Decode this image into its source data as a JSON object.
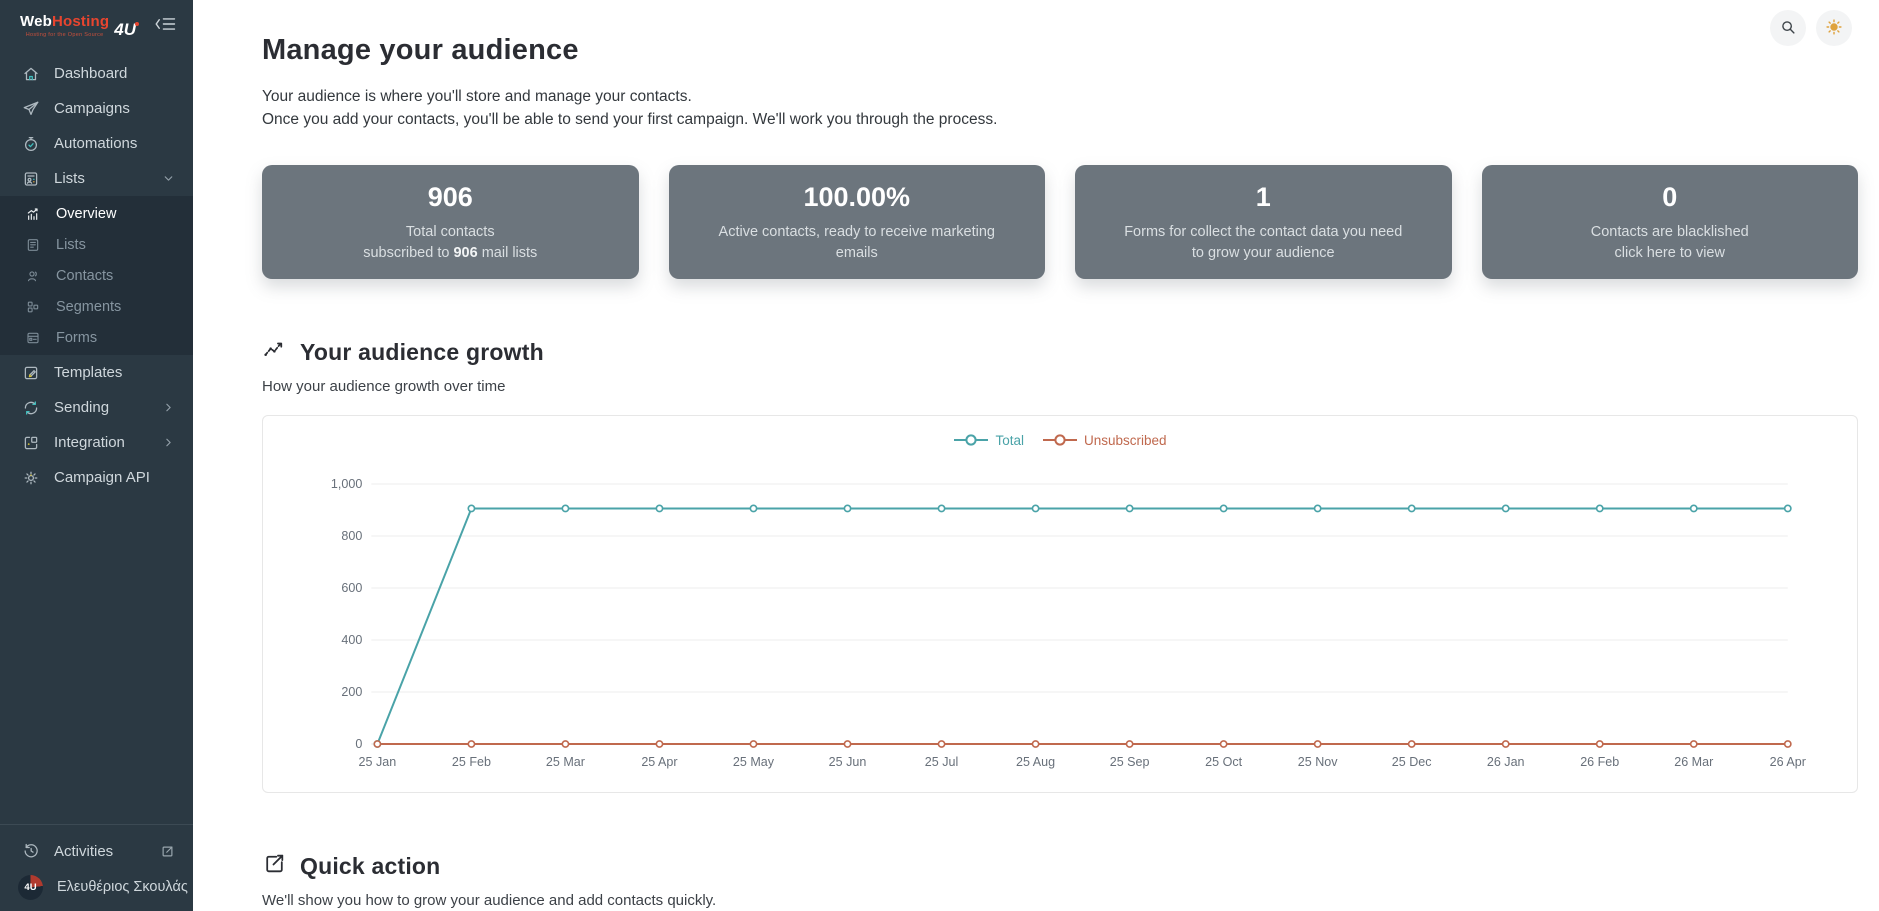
{
  "brand": {
    "web": "Web",
    "hosting": "Hosting",
    "suffix": "4U",
    "tagline": "Hosting for the Open Source"
  },
  "theme": {
    "sidebar_bg": "#2b3943",
    "submenu_bg": "#232f39",
    "brand_red": "#e8452f",
    "card_gray": "#6c757d",
    "sun_yellow": "#dfa23c",
    "accent_teal": "#3fbdbd"
  },
  "sidebar": {
    "nav": [
      {
        "label": "Dashboard",
        "icon": "home-icon"
      },
      {
        "label": "Campaigns",
        "icon": "paper-plane-icon"
      },
      {
        "label": "Automations",
        "icon": "stopwatch-icon"
      },
      {
        "label": "Lists",
        "icon": "lists-icon",
        "expanded": true
      },
      {
        "label": "Templates",
        "icon": "brush-icon"
      },
      {
        "label": "Sending",
        "icon": "sync-icon",
        "has_submenu": true
      },
      {
        "label": "Integration",
        "icon": "integration-icon",
        "has_submenu": true
      },
      {
        "label": "Campaign API",
        "icon": "gear-icon"
      }
    ],
    "lists_submenu": [
      {
        "label": "Overview",
        "icon": "bar-chart-icon",
        "active": true
      },
      {
        "label": "Lists",
        "icon": "list-alt-icon"
      },
      {
        "label": "Contacts",
        "icon": "user-icon"
      },
      {
        "label": "Segments",
        "icon": "segments-icon"
      },
      {
        "label": "Forms",
        "icon": "form-icon"
      }
    ],
    "activities_label": "Activities",
    "user_initials": "4U",
    "user_name": "Ελευθέριος Σκουλάς"
  },
  "main": {
    "title": "Manage your audience",
    "intro_line1": "Your audience is where you'll store and manage your contacts.",
    "intro_line2": "Once you add your contacts, you'll be able to send your first campaign. We'll work you through the process.",
    "stats": [
      {
        "value": "906",
        "line1": "Total contacts",
        "line2_prefix": "subscribed to ",
        "line2_bold": "906",
        "line2_suffix": " mail lists"
      },
      {
        "value": "100.00%",
        "line1": "Active contacts, ready to receive marketing",
        "line2": "emails"
      },
      {
        "value": "1",
        "line1": "Forms for collect the contact data you need",
        "line2": "to grow your audience"
      },
      {
        "value": "0",
        "line1": "Contacts are blacklished",
        "line2": "click here to view"
      }
    ],
    "growth_section": {
      "title": "Your audience growth",
      "subtitle": "How your audience growth over time"
    },
    "quick_section": {
      "title": "Quick action",
      "subtitle": "We'll show you how to grow your audience and add contacts quickly."
    }
  },
  "chart_data": {
    "type": "line",
    "x": [
      "25 Jan",
      "25 Feb",
      "25 Mar",
      "25 Apr",
      "25 May",
      "25 Jun",
      "25 Jul",
      "25 Aug",
      "25 Sep",
      "25 Oct",
      "25 Nov",
      "25 Dec",
      "26 Jan",
      "26 Feb",
      "26 Mar",
      "26 Apr"
    ],
    "series": [
      {
        "name": "Total",
        "color": "#4aa3a8",
        "values": [
          0,
          906,
          906,
          906,
          906,
          906,
          906,
          906,
          906,
          906,
          906,
          906,
          906,
          906,
          906,
          906
        ]
      },
      {
        "name": "Unsubscribed",
        "color": "#c0694e",
        "values": [
          0,
          0,
          0,
          0,
          0,
          0,
          0,
          0,
          0,
          0,
          0,
          0,
          0,
          0,
          0,
          0
        ]
      }
    ],
    "ylim": [
      0,
      1000
    ],
    "yticks": [
      0,
      200,
      400,
      600,
      800,
      1000
    ],
    "ytick_labels": [
      "0",
      "200",
      "400",
      "600",
      "800",
      "1,000"
    ],
    "grid": "horizontal",
    "legend_position": "top-center"
  }
}
